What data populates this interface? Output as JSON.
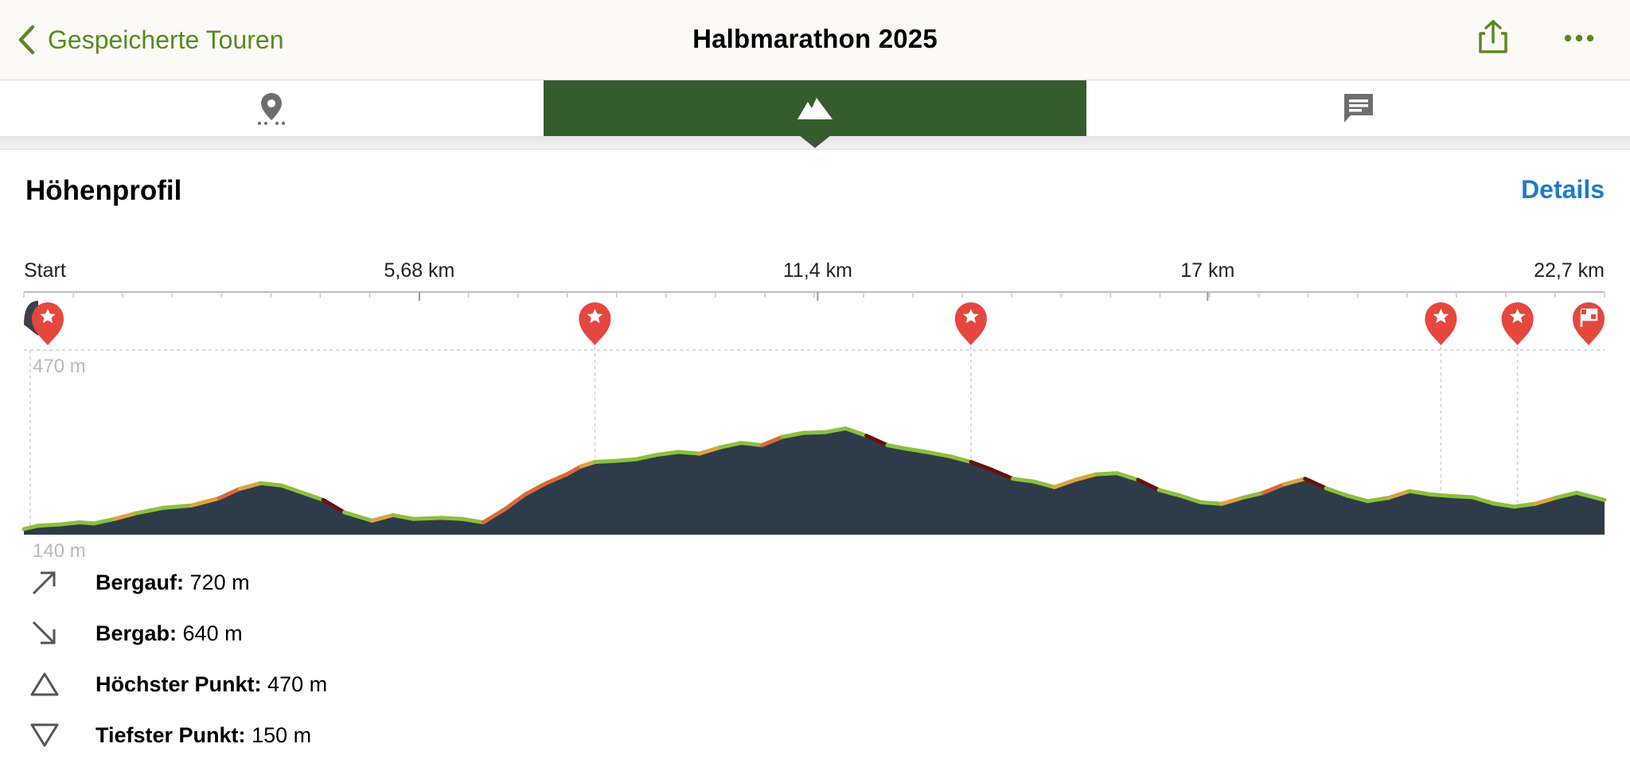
{
  "nav": {
    "back_label": "Gespeicherte Touren",
    "title": "Halbmarathon 2025",
    "accent": "#5a8a1f"
  },
  "tabs": [
    {
      "icon": "map-pin-icon",
      "active": false
    },
    {
      "icon": "mountain-icon",
      "active": true
    },
    {
      "icon": "comment-icon",
      "active": false
    }
  ],
  "section": {
    "title": "Höhenprofil",
    "details_label": "Details"
  },
  "chart_data": {
    "type": "area",
    "x_axis": {
      "tick_labels": [
        "Start",
        "5,68 km",
        "11,4 km",
        "17 km",
        "22,7 km"
      ],
      "tick_values": [
        0,
        5.68,
        11.4,
        17.0,
        22.7
      ],
      "range": [
        0,
        22.7
      ]
    },
    "y_axis": {
      "labels": [
        "470 m",
        "140 m"
      ],
      "range": [
        140,
        470
      ]
    },
    "series": [
      {
        "x": [
          0,
          0.2,
          0.5,
          0.8,
          1.0,
          1.3,
          1.6,
          2.0,
          2.4,
          2.8,
          3.1,
          3.4,
          3.7,
          4.0,
          4.3,
          4.6,
          5.0,
          5.3,
          5.6,
          6.0,
          6.3,
          6.6,
          6.9,
          7.2,
          7.5,
          7.8,
          8.0,
          8.2,
          8.5,
          8.8,
          9.1,
          9.4,
          9.7,
          10.0,
          10.3,
          10.6,
          10.9,
          11.2,
          11.5,
          11.8,
          12.1,
          12.4,
          12.7,
          13.0,
          13.3,
          13.6,
          13.9,
          14.2,
          14.5,
          14.8,
          15.1,
          15.4,
          15.7,
          16.0,
          16.3,
          16.6,
          16.9,
          17.2,
          17.5,
          17.8,
          18.1,
          18.4,
          18.7,
          19.0,
          19.3,
          19.6,
          19.9,
          20.2,
          20.5,
          20.8,
          21.1,
          21.4,
          21.7,
          22.0,
          22.3,
          22.7
        ],
        "y": [
          150,
          156,
          158,
          162,
          160,
          168,
          178,
          188,
          192,
          205,
          222,
          232,
          228,
          215,
          202,
          180,
          165,
          175,
          168,
          170,
          168,
          162,
          185,
          212,
          232,
          248,
          262,
          270,
          272,
          275,
          283,
          288,
          285,
          296,
          304,
          300,
          315,
          322,
          323,
          330,
          317,
          300,
          293,
          287,
          280,
          270,
          256,
          240,
          235,
          225,
          238,
          248,
          250,
          238,
          220,
          210,
          198,
          195,
          206,
          215,
          230,
          240,
          223,
          210,
          200,
          206,
          218,
          212,
          209,
          207,
          196,
          190,
          195,
          206,
          215,
          202
        ],
        "line_color": "#8cbf3f",
        "steep_up_color": "#d9a440",
        "very_steep_color": "#d86a3a",
        "steep_down_color": "#6b0f0f",
        "fill_color": "#2e3b48"
      }
    ],
    "waypoints": [
      {
        "x": 0.2,
        "type": "star"
      },
      {
        "x": 8.2,
        "type": "star"
      },
      {
        "x": 13.6,
        "type": "star"
      },
      {
        "x": 20.35,
        "type": "star"
      },
      {
        "x": 21.45,
        "type": "star"
      },
      {
        "x": 22.7,
        "type": "finish"
      }
    ],
    "grid": "dashed",
    "marker_color": "#e5473e"
  },
  "stats": [
    {
      "icon": "arrow-up-right-icon",
      "label": "Bergauf:",
      "value": "720 m"
    },
    {
      "icon": "arrow-down-right-icon",
      "label": "Bergab:",
      "value": "640 m"
    },
    {
      "icon": "triangle-up-icon",
      "label": "Höchster Punkt:",
      "value": "470 m"
    },
    {
      "icon": "triangle-down-icon",
      "label": "Tiefster Punkt:",
      "value": "150 m"
    }
  ]
}
